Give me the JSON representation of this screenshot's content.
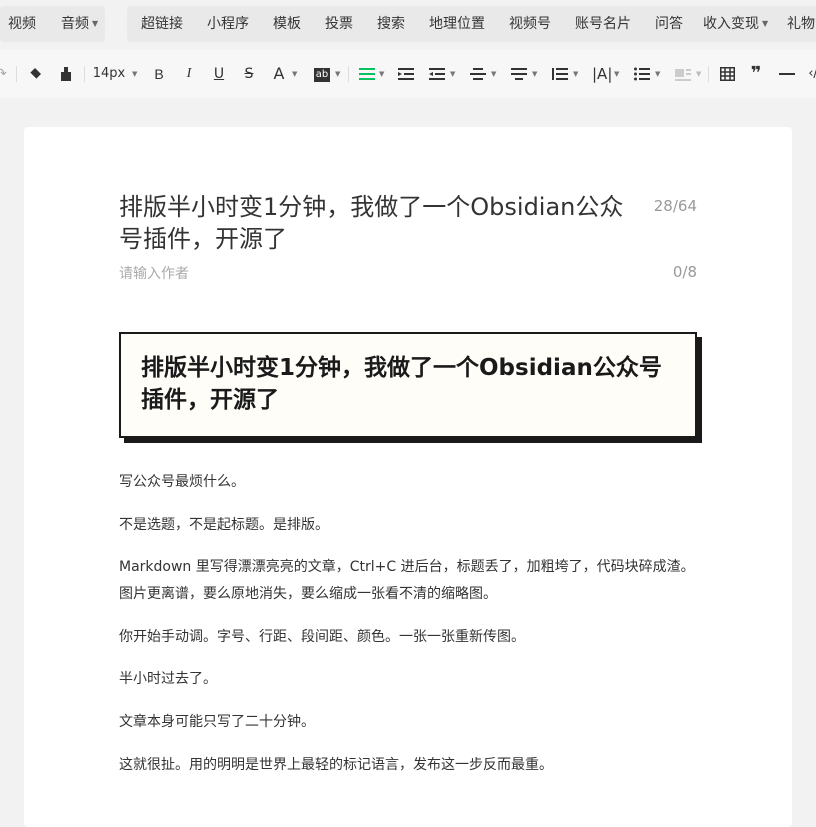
{
  "insert_bar": {
    "items": [
      "视频",
      "音频",
      "超链接",
      "小程序",
      "模板",
      "投票",
      "搜索",
      "地理位置",
      "视频号",
      "账号名片",
      "问答",
      "收入变现",
      "礼物"
    ]
  },
  "toolbar": {
    "font_size": "14px",
    "bold": "B",
    "italic": "I",
    "underline": "U",
    "strikethrough": "S",
    "font_color": "A",
    "highlight": "ab",
    "quote": "❞",
    "accent_color": "#07c160"
  },
  "document": {
    "title": "排版半小时变1分钟，我做了一个Obsidian公众号插件，开源了",
    "title_count": "28/64",
    "author_placeholder": "请输入作者",
    "author_count": "0/8",
    "heading_box": "排版半小时变1分钟，我做了一个Obsidian公众号插件，开源了",
    "paragraphs": [
      "写公众号最烦什么。",
      "不是选题，不是起标题。是排版。",
      "Markdown 里写得漂漂亮亮的文章，Ctrl+C 进后台，标题丢了，加粗垮了，代码块碎成渣。图片更离谱，要么原地消失，要么缩成一张看不清的缩略图。",
      "你开始手动调。字号、行距、段间距、颜色。一张一张重新传图。",
      "半小时过去了。",
      "文章本身可能只写了二十分钟。",
      "这就很扯。用的明明是世界上最轻的标记语言，发布这一步反而最重。"
    ]
  }
}
